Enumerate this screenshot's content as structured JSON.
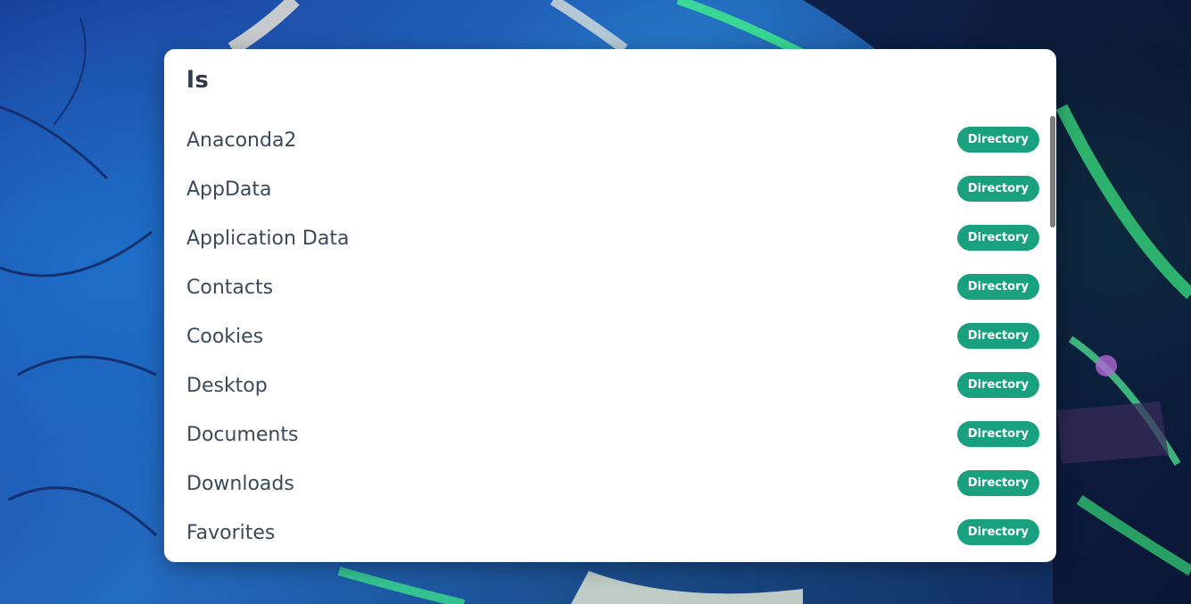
{
  "panel": {
    "title": "ls",
    "scroll_position": 0
  },
  "items": [
    {
      "name": "Anaconda2",
      "type": "Directory"
    },
    {
      "name": "AppData",
      "type": "Directory"
    },
    {
      "name": "Application Data",
      "type": "Directory"
    },
    {
      "name": "Contacts",
      "type": "Directory"
    },
    {
      "name": "Cookies",
      "type": "Directory"
    },
    {
      "name": "Desktop",
      "type": "Directory"
    },
    {
      "name": "Documents",
      "type": "Directory"
    },
    {
      "name": "Downloads",
      "type": "Directory"
    },
    {
      "name": "Favorites",
      "type": "Directory"
    }
  ],
  "colors": {
    "badge": "#18a07f",
    "text": "#3a4a5c",
    "title": "#2f3b4a"
  }
}
